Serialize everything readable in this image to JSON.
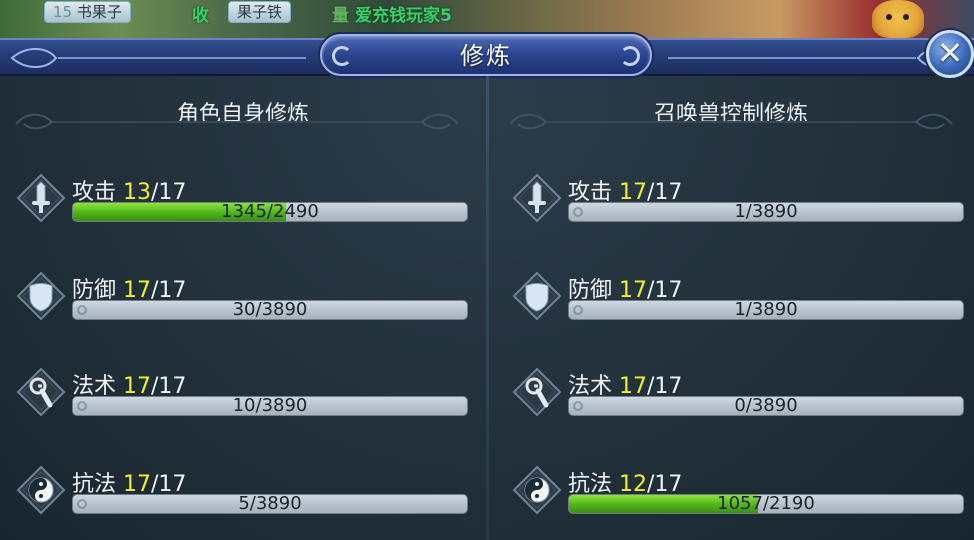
{
  "background": {
    "chips": [
      "书果子",
      "果子铁",
      "果子铁"
    ],
    "texts": [
      "收",
      "量",
      "爱充钱玩家5"
    ]
  },
  "window": {
    "title": "修炼",
    "close_label": "✕"
  },
  "left": {
    "title": "角色自身修炼",
    "rows": [
      {
        "name": "攻击",
        "cur": "13",
        "max": "/17",
        "progress": "1345/2490",
        "fill": 0.54,
        "icon": "sword-icon"
      },
      {
        "name": "防御",
        "cur": "17",
        "max": "/17",
        "progress": "30/3890",
        "fill": 0.0,
        "icon": "shield-icon"
      },
      {
        "name": "法术",
        "cur": "17",
        "max": "/17",
        "progress": "10/3890",
        "fill": 0.0,
        "icon": "staff-icon"
      },
      {
        "name": "抗法",
        "cur": "17",
        "max": "/17",
        "progress": "5/3890",
        "fill": 0.0,
        "icon": "yin-yang-icon"
      }
    ]
  },
  "right": {
    "title": "召唤兽控制修炼",
    "rows": [
      {
        "name": "攻击",
        "cur": "17",
        "max": "/17",
        "progress": "1/3890",
        "fill": 0.0,
        "icon": "sword-icon"
      },
      {
        "name": "防御",
        "cur": "17",
        "max": "/17",
        "progress": "1/3890",
        "fill": 0.0,
        "icon": "shield-icon"
      },
      {
        "name": "法术",
        "cur": "17",
        "max": "/17",
        "progress": "0/3890",
        "fill": 0.0,
        "icon": "staff-icon"
      },
      {
        "name": "抗法",
        "cur": "12",
        "max": "/17",
        "progress": "1057/2190",
        "fill": 0.48,
        "icon": "yin-yang-icon"
      }
    ]
  },
  "colors": {
    "accent_yellow": "#f4ef2c",
    "bar_green": "#4fb31a",
    "title_blue": "#2b458e"
  }
}
